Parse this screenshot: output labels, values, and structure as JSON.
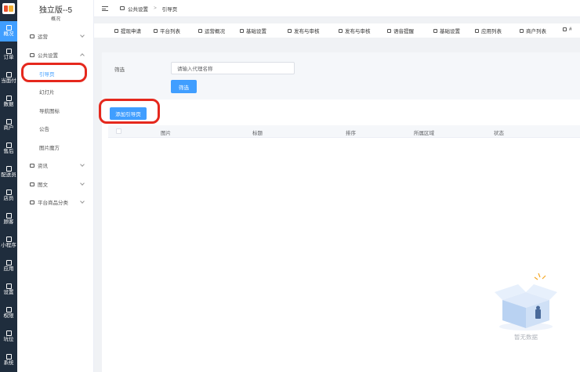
{
  "rail": {
    "items": [
      {
        "label": "概况",
        "icon": "dashboard-icon"
      },
      {
        "label": "订单",
        "icon": "list-icon"
      },
      {
        "label": "当面付",
        "icon": "pay-icon"
      },
      {
        "label": "数据",
        "icon": "bar-chart-icon"
      },
      {
        "label": "商户",
        "icon": "shop-icon"
      },
      {
        "label": "售后",
        "icon": "headset-icon"
      },
      {
        "label": "配送员",
        "icon": "courier-icon"
      },
      {
        "label": "店员",
        "icon": "staff-icon"
      },
      {
        "label": "顾客",
        "icon": "customer-icon"
      },
      {
        "label": "小程序",
        "icon": "wechat-icon"
      },
      {
        "label": "应用",
        "icon": "apps-icon"
      },
      {
        "label": "设置",
        "icon": "settings-icon"
      },
      {
        "label": "权限",
        "icon": "lock-icon"
      },
      {
        "label": "坑位",
        "icon": "slot-icon"
      },
      {
        "label": "系统",
        "icon": "windows-icon"
      }
    ]
  },
  "sidebar": {
    "title": "独立版--5",
    "subtitle": "概况",
    "groups": [
      {
        "label": "运营",
        "icon": "chart-icon",
        "expanded": false
      },
      {
        "label": "公共设置",
        "icon": "image-icon",
        "expanded": true
      },
      {
        "label": "资讯",
        "icon": "news-icon",
        "expanded": false
      },
      {
        "label": "图文",
        "icon": "article-icon",
        "expanded": false
      },
      {
        "label": "平台商品分类",
        "icon": "grid-icon",
        "expanded": false
      }
    ],
    "subitems": [
      "引导页",
      "幻灯片",
      "导航图标",
      "公告",
      "图片魔方"
    ]
  },
  "topbar": {
    "crumb_parent": "公共设置",
    "separator": ">",
    "crumb_current": "引导页"
  },
  "tabs": [
    "提现申请",
    "平台列表",
    "运营概况",
    "基础设置",
    "发布与审核",
    "发布与审核",
    "语音提醒",
    "基础设置",
    "应用列表",
    "商户列表",
    "#"
  ],
  "filter": {
    "label": "筛选",
    "placeholder": "请输入代理名称",
    "button": "筛选"
  },
  "main": {
    "add_button": "添加引导页",
    "columns": [
      "图片",
      "标题",
      "排序",
      "所属区域",
      "状态"
    ],
    "empty_text": "暂无数据"
  },
  "colors": {
    "primary": "#409eff",
    "rail_bg": "#1f2d3d",
    "highlight": "#e5281d"
  }
}
